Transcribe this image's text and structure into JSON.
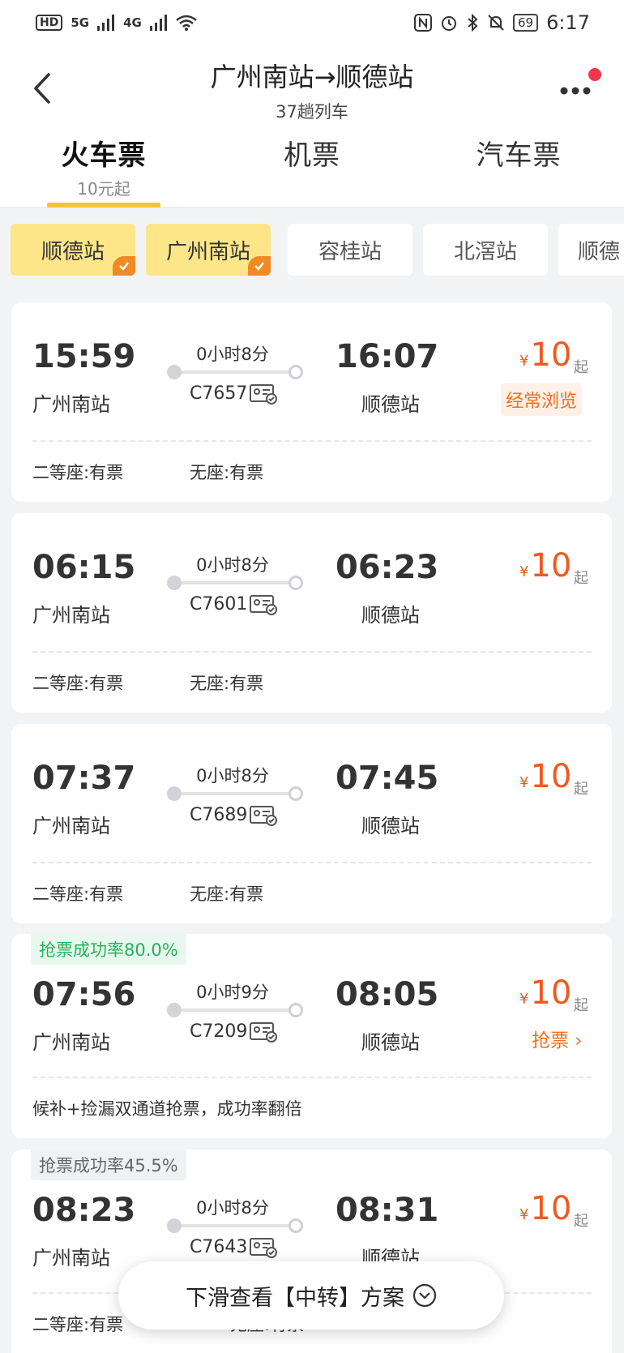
{
  "status_bar": {
    "hd": "HD",
    "net1": "5G",
    "net2": "4G",
    "battery": "69",
    "time": "6:17"
  },
  "header": {
    "title": "广州南站→顺德站",
    "subtitle": "37趟列车"
  },
  "tabs": [
    {
      "label": "火车票",
      "sub": "10元起",
      "active": true
    },
    {
      "label": "机票",
      "sub": "",
      "active": false
    },
    {
      "label": "汽车票",
      "sub": "",
      "active": false
    }
  ],
  "stations": [
    {
      "label": "顺德站",
      "selected": true
    },
    {
      "label": "广州南站",
      "selected": true
    },
    {
      "label": "容桂站",
      "selected": false
    },
    {
      "label": "北滘站",
      "selected": false
    },
    {
      "label": "顺德",
      "selected": false
    }
  ],
  "trains": [
    {
      "depart": "15:59",
      "from": "广州南站",
      "duration": "0小时8分",
      "train_no": "C7657",
      "arrive": "16:07",
      "to": "顺德站",
      "yen": "¥",
      "price": "10",
      "price_suffix": "起",
      "tag": "经常浏览",
      "seat1": "二等座:有票",
      "seat2": "无座:有票"
    },
    {
      "depart": "06:15",
      "from": "广州南站",
      "duration": "0小时8分",
      "train_no": "C7601",
      "arrive": "06:23",
      "to": "顺德站",
      "yen": "¥",
      "price": "10",
      "price_suffix": "起",
      "seat1": "二等座:有票",
      "seat2": "无座:有票"
    },
    {
      "depart": "07:37",
      "from": "广州南站",
      "duration": "0小时8分",
      "train_no": "C7689",
      "arrive": "07:45",
      "to": "顺德站",
      "yen": "¥",
      "price": "10",
      "price_suffix": "起",
      "seat1": "二等座:有票",
      "seat2": "无座:有票"
    },
    {
      "badge": "抢票成功率80.0%",
      "depart": "07:56",
      "from": "广州南站",
      "duration": "0小时9分",
      "train_no": "C7209",
      "arrive": "08:05",
      "to": "顺德站",
      "yen": "¥",
      "price": "10",
      "price_suffix": "起",
      "grab": "抢票 ›",
      "note": "候补+捡漏双通道抢票，成功率翻倍"
    },
    {
      "badge": "抢票成功率45.5%",
      "depart": "08:23",
      "from": "广州南站",
      "duration": "0小时8分",
      "train_no": "C7643",
      "arrive": "08:31",
      "to": "顺德站",
      "yen": "¥",
      "price": "10",
      "price_suffix": "起",
      "seat1": "二等座:有票",
      "seat2": "无座:有票"
    }
  ],
  "float_button": {
    "label": "下滑查看【中转】方案"
  },
  "colors": {
    "accent": "#f7c530",
    "price": "#f0591e",
    "chip_selected": "#fde58a",
    "success": "#23b35a"
  }
}
